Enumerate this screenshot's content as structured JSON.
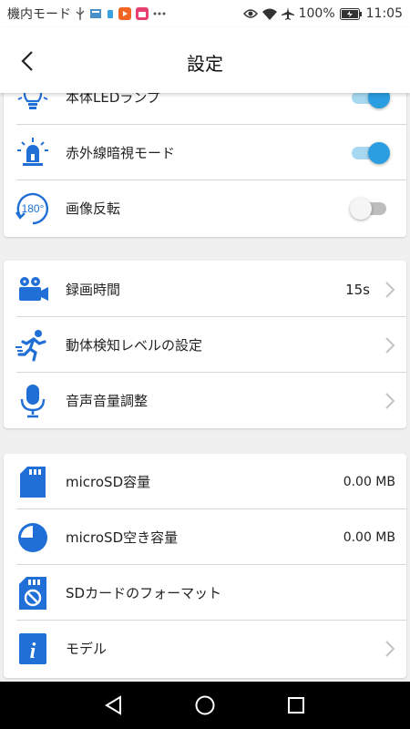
{
  "status_bar": {
    "mode_text": "機内モード",
    "battery": "100%",
    "time": "11:05",
    "icons": [
      "usb-icon",
      "sim-card-icon",
      "small-app-icon",
      "video-app-icon",
      "calendar-icon",
      "more-dots-icon",
      "eye-icon",
      "wifi-icon",
      "airplane-icon",
      "battery-charging-icon"
    ]
  },
  "header": {
    "title": "設定",
    "back_icon": "chevron-left-icon"
  },
  "sections": {
    "s1": {
      "items": [
        {
          "label": "本体LEDランプ",
          "icon": "lightbulb-icon",
          "toggle": "on"
        },
        {
          "label": "赤外線暗視モード",
          "icon": "infrared-beacon-icon",
          "toggle": "on"
        },
        {
          "label": "画像反転",
          "icon": "rotate-180-icon",
          "icon_text": "180°",
          "toggle": "off"
        }
      ]
    },
    "s2": {
      "items": [
        {
          "label": "録画時間",
          "icon": "video-camera-icon",
          "value": "15s"
        },
        {
          "label": "動体検知レベルの設定",
          "icon": "running-person-icon"
        },
        {
          "label": "音声音量調整",
          "icon": "microphone-icon"
        }
      ]
    },
    "s3": {
      "items": [
        {
          "label": "microSD容量",
          "icon": "sd-card-icon",
          "value": "0.00 MB"
        },
        {
          "label": "microSD空き容量",
          "icon": "pie-chart-icon",
          "value": "0.00 MB"
        },
        {
          "label": "SDカードのフォーマット",
          "icon": "sd-card-format-icon"
        },
        {
          "label": "モデル",
          "icon": "info-icon",
          "icon_text": "i"
        }
      ]
    }
  },
  "colors": {
    "accent": "#1f6fd6",
    "toggle_on": "#2a9ee0",
    "toggle_track_on": "#a8d8ef",
    "toggle_off": "#bdbdbd"
  },
  "nav_bar": {
    "icons": [
      "back-triangle-icon",
      "home-circle-icon",
      "recents-square-icon"
    ]
  }
}
